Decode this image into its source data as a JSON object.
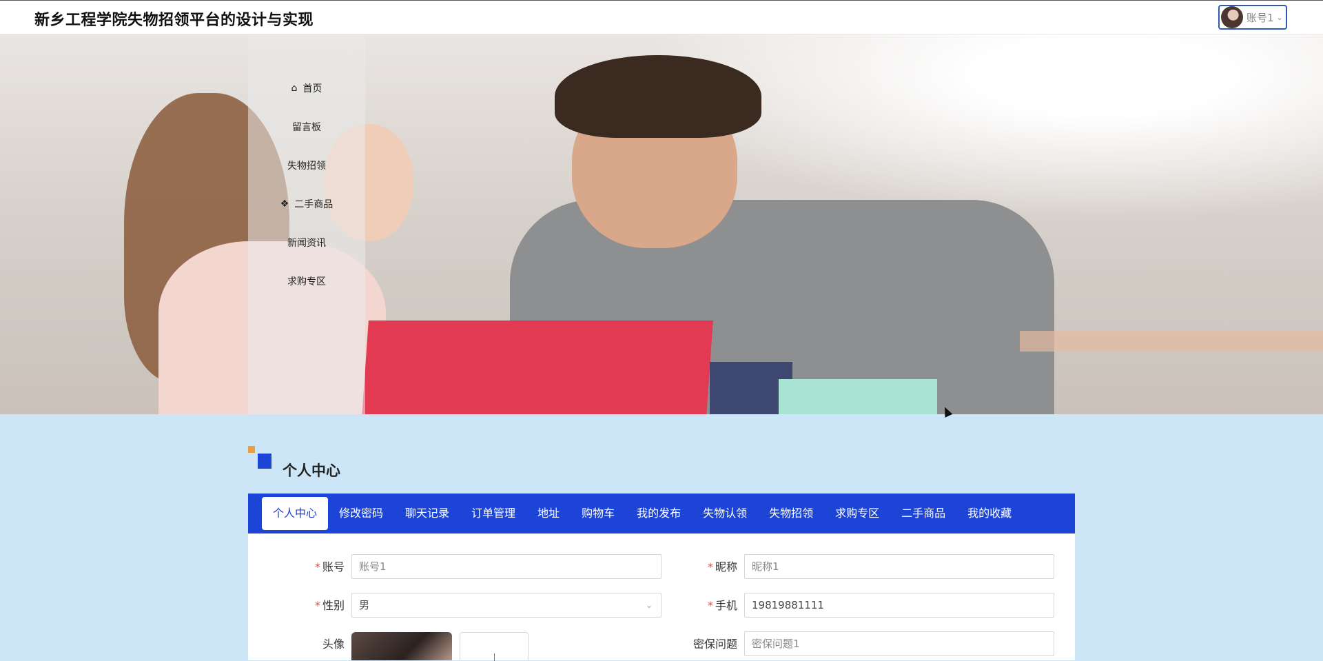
{
  "header": {
    "site_title": "新乡工程学院失物招领平台的设计与实现",
    "user_name": "账号1"
  },
  "nav": [
    {
      "label": "首页",
      "icon": "home-icon"
    },
    {
      "label": "留言板"
    },
    {
      "label": "失物招领"
    },
    {
      "label": "二手商品",
      "icon": "grid-icon"
    },
    {
      "label": "新闻资讯"
    },
    {
      "label": "求购专区"
    }
  ],
  "section": {
    "title": "个人中心"
  },
  "tabs": [
    {
      "label": "个人中心",
      "active": true
    },
    {
      "label": "修改密码"
    },
    {
      "label": "聊天记录"
    },
    {
      "label": "订单管理"
    },
    {
      "label": "地址"
    },
    {
      "label": "购物车"
    },
    {
      "label": "我的发布"
    },
    {
      "label": "失物认领"
    },
    {
      "label": "失物招领"
    },
    {
      "label": "求购专区"
    },
    {
      "label": "二手商品"
    },
    {
      "label": "我的收藏"
    }
  ],
  "form": {
    "account": {
      "label": "账号",
      "value": "账号1"
    },
    "nickname": {
      "label": "昵称",
      "value": "昵称1"
    },
    "gender": {
      "label": "性别",
      "value": "男"
    },
    "phone": {
      "label": "手机",
      "value": "19819881111"
    },
    "avatar": {
      "label": "头像"
    },
    "security_question": {
      "label": "密保问题",
      "value": "密保问题1"
    }
  },
  "colors": {
    "accent": "#1c45d8",
    "background": "#cde6f7",
    "required": "#e14a4a"
  }
}
